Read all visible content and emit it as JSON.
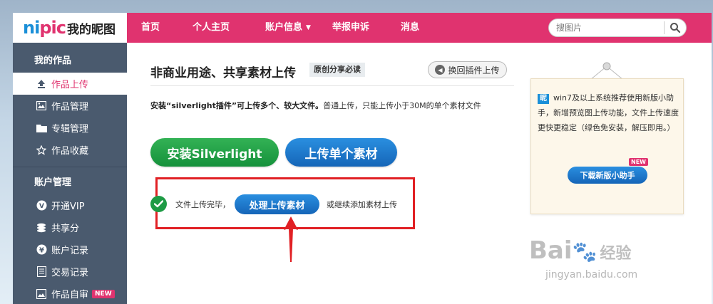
{
  "header": {
    "logo_text_1": "ni",
    "logo_text_2": "pic",
    "logo_cn": "我的昵图",
    "nav": [
      {
        "label": "首页"
      },
      {
        "label": "个人主页"
      },
      {
        "label": "账户信息",
        "has_caret": true
      },
      {
        "label": "举报申诉"
      },
      {
        "label": "消息"
      }
    ],
    "search": {
      "placeholder": "搜图片",
      "icon": "search-icon"
    },
    "brand_color": "#e0336f"
  },
  "sidebar": {
    "section1": "我的作品",
    "items1": [
      {
        "label": "作品上传",
        "icon": "upload-icon",
        "active": true
      },
      {
        "label": "作品管理",
        "icon": "image-icon"
      },
      {
        "label": "专辑管理",
        "icon": "folder-icon"
      },
      {
        "label": "作品收藏",
        "icon": "star-icon"
      }
    ],
    "section2": "账户管理",
    "items2": [
      {
        "label": "开通VIP",
        "icon": "vip-icon"
      },
      {
        "label": "共享分",
        "icon": "coins-icon"
      },
      {
        "label": "账户记录",
        "icon": "yen-icon"
      },
      {
        "label": "交易记录",
        "icon": "list-icon"
      },
      {
        "label": "作品自审",
        "icon": "review-icon",
        "badge": "NEW"
      }
    ]
  },
  "main": {
    "title": "非商业用途、共享素材上传",
    "title_tag": "原创分享必读",
    "back_button": "换回插件上传",
    "desc_bold": "安装“silverlight插件”可上传多个、较大文件。",
    "desc_rest": "普通上传，只能上传小于30M的单个素材文件",
    "install_button": "安装Silverlight",
    "single_upload_button": "上传单个素材",
    "done_text": "文件上传完毕，",
    "process_button": "处理上传素材",
    "continue_text": "或继续添加素材上传"
  },
  "promo": {
    "logo_char": "昵",
    "text": "win7及以上系统推荐使用新版小助手，新增预览图上传功能，文件上传速度更快更稳定（绿色免安装，解压即用。）",
    "badge": "NEW",
    "download_button": "下载新版小助手"
  },
  "watermark": {
    "main": "Bai",
    "cn": "经验",
    "sub": "jingyan.baidu.com"
  }
}
